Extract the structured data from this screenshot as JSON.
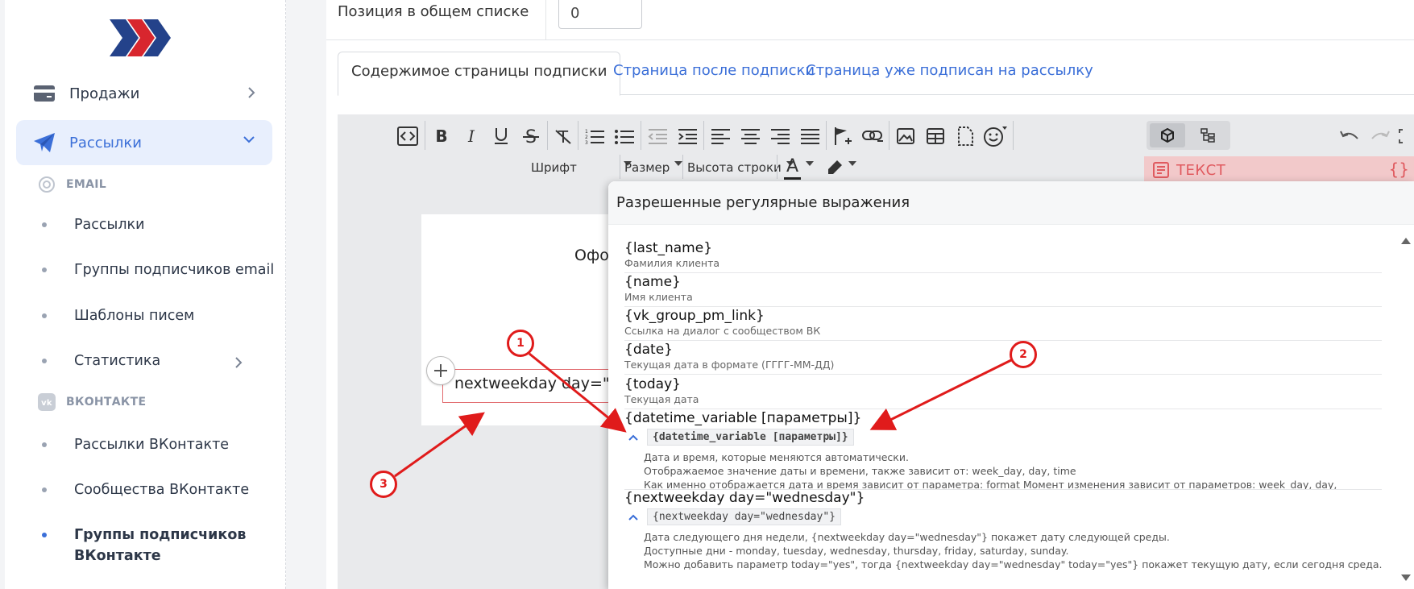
{
  "sidebar": {
    "items": [
      {
        "label": "Продажи",
        "icon": "card-icon"
      },
      {
        "label": "Рассылки",
        "icon": "paper-plane-icon"
      }
    ],
    "sections": [
      {
        "label": "EMAIL",
        "icon": "at-icon"
      },
      {
        "label": "ВКОНТАКТЕ",
        "icon": "vk-icon"
      }
    ],
    "email_items": [
      "Рассылки",
      "Группы подписчиков email",
      "Шаблоны писем",
      "Статистика"
    ],
    "vk_items": [
      "Рассылки ВКонтакте",
      "Сообщества ВКонтакте",
      "Группы подписчиков\nВКонтакте"
    ],
    "accent_color": "#3b6fd8"
  },
  "form": {
    "position_label": "Позиция в общем списке",
    "position_value": "0"
  },
  "tabs": [
    {
      "label": "Содержимое страницы подписки",
      "active": true
    },
    {
      "label": "Страница после подписки",
      "active": false
    },
    {
      "label": "Страница уже подписан на рассылку",
      "active": false
    }
  ],
  "editor": {
    "toolbar_icons": [
      "code-view-icon",
      "bold-icon",
      "italic-icon",
      "underline-icon",
      "strikethrough-icon",
      "clear-format-icon",
      "ordered-list-icon",
      "unordered-list-icon",
      "outdent-icon",
      "indent-icon",
      "align-left-icon",
      "align-center-icon",
      "align-right-icon",
      "align-justify-icon",
      "anchor-flag-icon",
      "link-icon",
      "image-icon",
      "table-icon",
      "file-icon",
      "emoji-icon"
    ],
    "dropdowns": {
      "font": "Шрифт",
      "size": "Размер",
      "line_height": "Высота строки"
    },
    "text_color_letter": "A",
    "text_block_label": "ТЕКСТ",
    "text_block_braces": "{}",
    "canvas_title": "Офо",
    "canvas_block_text": "nextweekday day=\"w"
  },
  "popup": {
    "title": "Разрешенные регулярные выражения",
    "simple_entries": [
      {
        "name": "{last_name}",
        "desc": "Фамилия клиента"
      },
      {
        "name": "{name}",
        "desc": "Имя клиента"
      },
      {
        "name": "{vk_group_pm_link}",
        "desc": "Ссылка на диалог с сообществом ВК"
      },
      {
        "name": "{date}",
        "desc": "Текущая дата в формате (ГГГГ-ММ-ДД)"
      },
      {
        "name": "{today}",
        "desc": "Текущая дата"
      }
    ],
    "datetime": {
      "name": "{datetime_variable [параметры]}",
      "code": "{datetime_variable [параметры]}",
      "lines": [
        "Дата и время, которые меняются автоматически.",
        "Отображаемое значение даты и времени, также зависит от: week_day, day, time",
        "Как именно отображается дата и время зависит от параметра: format Момент изменения зависит от параметров: week_day, day,"
      ]
    },
    "nextweekday": {
      "name": "{nextweekday day=\"wednesday\"}",
      "code": "{nextweekday day=\"wednesday\"}",
      "lines": [
        "Дата следующего дня недели, {nextweekday day=\"wednesday\"} покажет дату следующей среды.",
        "Доступные дни - monday, tuesday, wednesday, thursday, friday, saturday, sunday.",
        "Можно добавить параметр today=\"yes\", тогда {nextweekday day=\"wednesday\" today=\"yes\"} покажет текущую дату, если сегодня среда."
      ]
    }
  },
  "annotations": {
    "badges": [
      "1",
      "2",
      "3"
    ],
    "color": "#e01b1b"
  }
}
